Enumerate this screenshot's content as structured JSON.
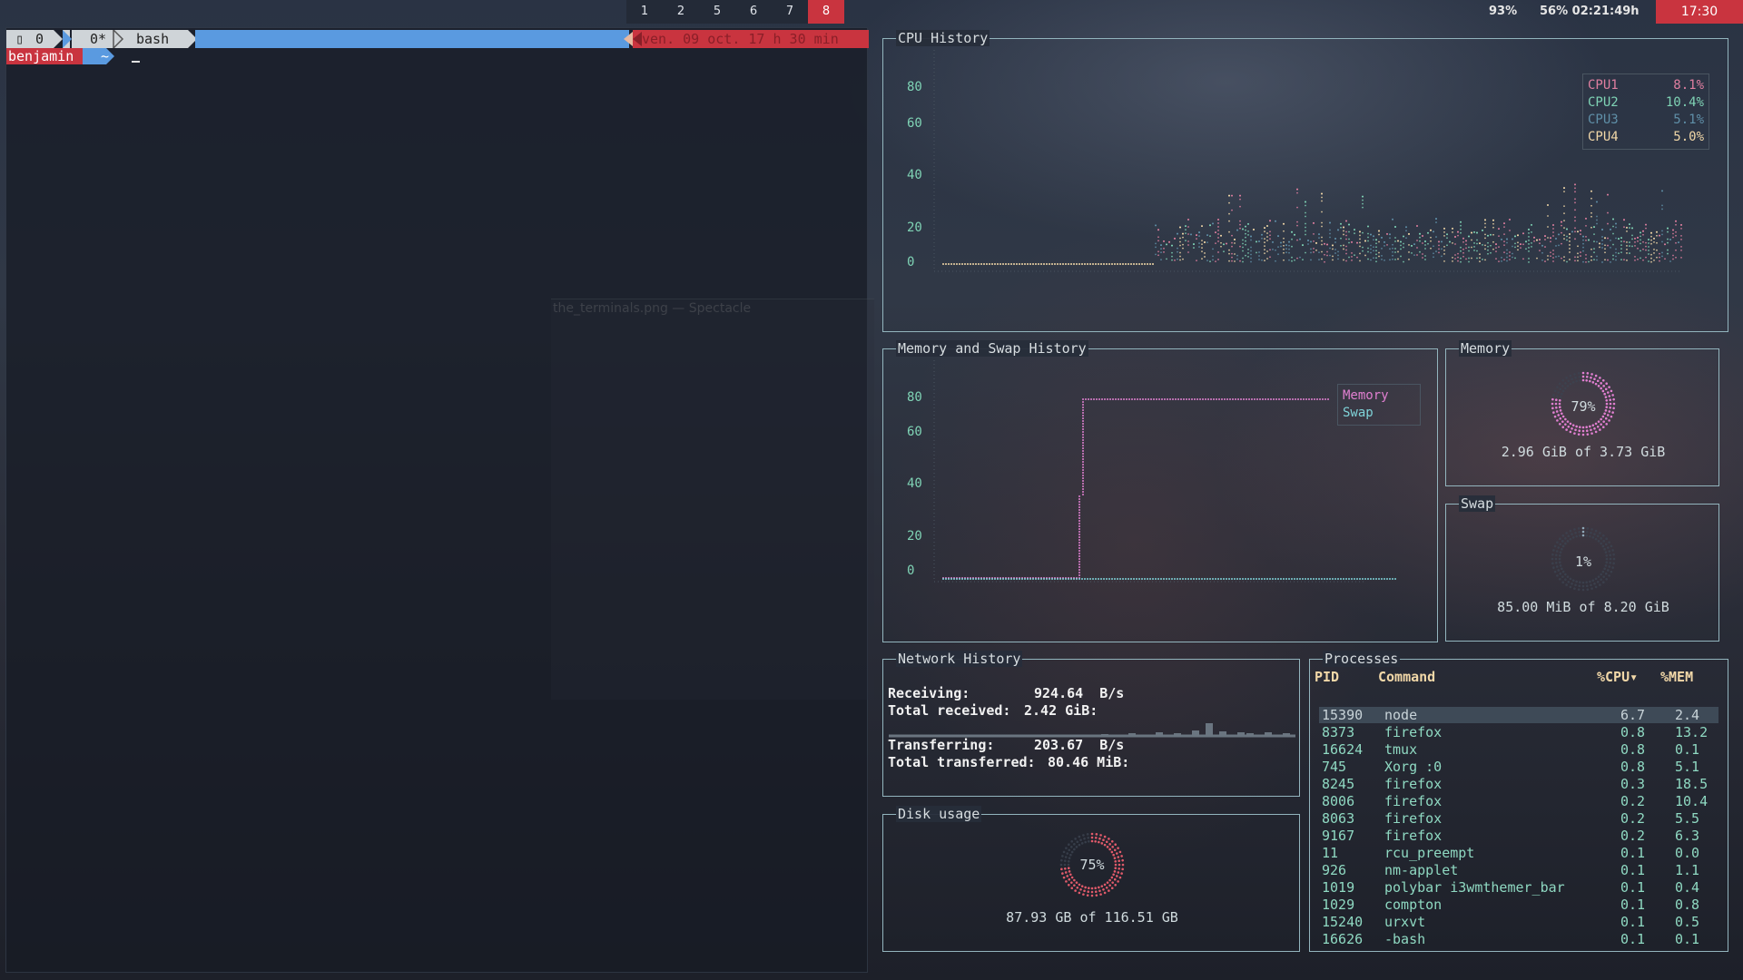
{
  "topbar": {
    "workspaces": [
      {
        "label": "1",
        "active": false
      },
      {
        "label": "2",
        "active": false
      },
      {
        "label": "5",
        "active": false
      },
      {
        "label": "6",
        "active": false
      },
      {
        "label": "7",
        "active": false
      },
      {
        "label": "8",
        "active": true
      }
    ],
    "volume": "93%",
    "battery": "56% 02:21:49h",
    "clock": "17:30"
  },
  "terminal": {
    "tmux_session_icon": "terminal-icon",
    "tmux_session": "0",
    "tmux_window": "0*",
    "tmux_window_name": "bash",
    "tmux_date": "ven. 09 oct. 17 h 30 min",
    "prompt_user": "benjamin",
    "prompt_dir": "~",
    "ghost_window_title": "the_terminals.png — Spectacle"
  },
  "vtop": {
    "cpu": {
      "title": "CPU History",
      "ticks": [
        "80",
        "60",
        "40",
        "20",
        "0"
      ],
      "legend": [
        {
          "name": "CPU1",
          "value": "8.1%",
          "color": "#e07fa0"
        },
        {
          "name": "CPU2",
          "value": "10.4%",
          "color": "#7fd3b5"
        },
        {
          "name": "CPU3",
          "value": "5.1%",
          "color": "#5f8fa8"
        },
        {
          "name": "CPU4",
          "value": "5.0%",
          "color": "#f2d8a8"
        }
      ]
    },
    "memswap": {
      "title": "Memory and Swap History",
      "ticks": [
        "80",
        "60",
        "40",
        "20",
        "0"
      ],
      "legend": [
        {
          "name": "Memory",
          "color": "#e07fd0"
        },
        {
          "name": "Swap",
          "color": "#7fd3d8"
        }
      ]
    },
    "memory": {
      "title": "Memory",
      "percent": "79%",
      "fraction": 0.79,
      "detail": "2.96 GiB of 3.73 GiB",
      "color": "#e07fd0"
    },
    "swap": {
      "title": "Swap",
      "percent": "1%",
      "fraction": 0.01,
      "detail": "85.00 MiB of 8.20 GiB",
      "color": "#8fa8b8"
    },
    "network": {
      "title": "Network History",
      "receiving_label": "Receiving:",
      "receiving_value": "924.64  B/s",
      "total_received_label": "Total received:",
      "total_received_value": "2.42 GiB:",
      "transferring_label": "Transferring:",
      "transferring_value": "203.67  B/s",
      "total_transferred_label": "Total transferred:",
      "total_transferred_value": "80.46 MiB:"
    },
    "disk": {
      "title": "Disk usage",
      "percent": "75%",
      "fraction": 0.75,
      "detail": "87.93 GB of 116.51 GB",
      "color": "#e05a6a"
    },
    "processes": {
      "title": "Processes",
      "headers": {
        "pid": "PID",
        "command": "Command",
        "cpu": "%CPU▾",
        "mem": "%MEM"
      },
      "rows": [
        {
          "pid": "15390",
          "command": "node",
          "cpu": "6.7",
          "mem": "2.4"
        },
        {
          "pid": "8373",
          "command": "firefox",
          "cpu": "0.8",
          "mem": "13.2"
        },
        {
          "pid": "16624",
          "command": "tmux",
          "cpu": "0.8",
          "mem": "0.1"
        },
        {
          "pid": "745",
          "command": "Xorg :0",
          "cpu": "0.8",
          "mem": "5.1"
        },
        {
          "pid": "8245",
          "command": "firefox",
          "cpu": "0.3",
          "mem": "18.5"
        },
        {
          "pid": "8006",
          "command": "firefox",
          "cpu": "0.2",
          "mem": "10.4"
        },
        {
          "pid": "8063",
          "command": "firefox",
          "cpu": "0.2",
          "mem": "5.5"
        },
        {
          "pid": "9167",
          "command": "firefox",
          "cpu": "0.2",
          "mem": "6.3"
        },
        {
          "pid": "11",
          "command": "rcu_preempt",
          "cpu": "0.1",
          "mem": "0.0"
        },
        {
          "pid": "926",
          "command": "nm-applet",
          "cpu": "0.1",
          "mem": "1.1"
        },
        {
          "pid": "1019",
          "command": "polybar i3wmthemer_bar",
          "cpu": "0.1",
          "mem": "0.4"
        },
        {
          "pid": "1029",
          "command": "compton",
          "cpu": "0.1",
          "mem": "0.8"
        },
        {
          "pid": "15240",
          "command": "urxvt",
          "cpu": "0.1",
          "mem": "0.5"
        },
        {
          "pid": "16626",
          "command": "-bash",
          "cpu": "0.1",
          "mem": "0.1"
        }
      ]
    }
  }
}
